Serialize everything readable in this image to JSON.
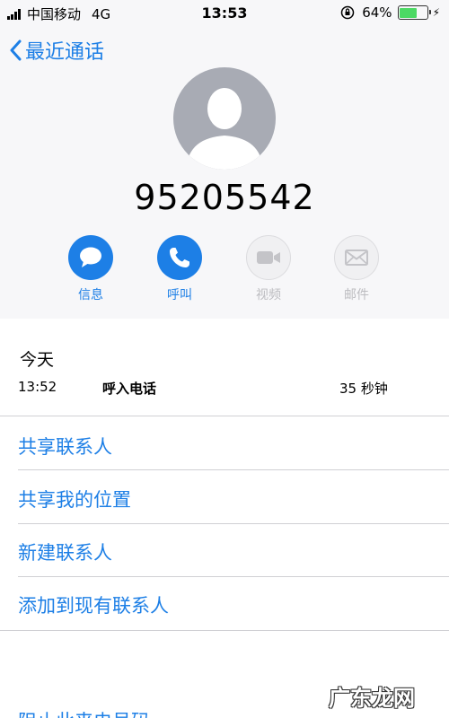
{
  "status_bar": {
    "carrier": "中国移动",
    "network": "4G",
    "time": "13:53",
    "battery": "64%",
    "battery_level": 0.64
  },
  "nav": {
    "back_label": "最近通话"
  },
  "contact": {
    "number": "95205542"
  },
  "actions": [
    {
      "label": "信息",
      "icon": "message-icon",
      "enabled": true
    },
    {
      "label": "呼叫",
      "icon": "phone-icon",
      "enabled": true
    },
    {
      "label": "视频",
      "icon": "video-icon",
      "enabled": false
    },
    {
      "label": "邮件",
      "icon": "mail-icon",
      "enabled": false
    }
  ],
  "history": {
    "section": "今天",
    "entries": [
      {
        "time": "13:52",
        "type": "呼入电话",
        "duration": "35 秒钟"
      }
    ]
  },
  "menu": [
    {
      "label": "共享联系人"
    },
    {
      "label": "共享我的位置"
    },
    {
      "label": "新建联系人"
    },
    {
      "label": "添加到现有联系人"
    }
  ],
  "cutoff_item": "阻止此来电号码",
  "watermark": "广东龙网",
  "colors": {
    "accent": "#1d7fe6",
    "battery": "#4cd964",
    "header_bg": "#f7f7f9"
  }
}
